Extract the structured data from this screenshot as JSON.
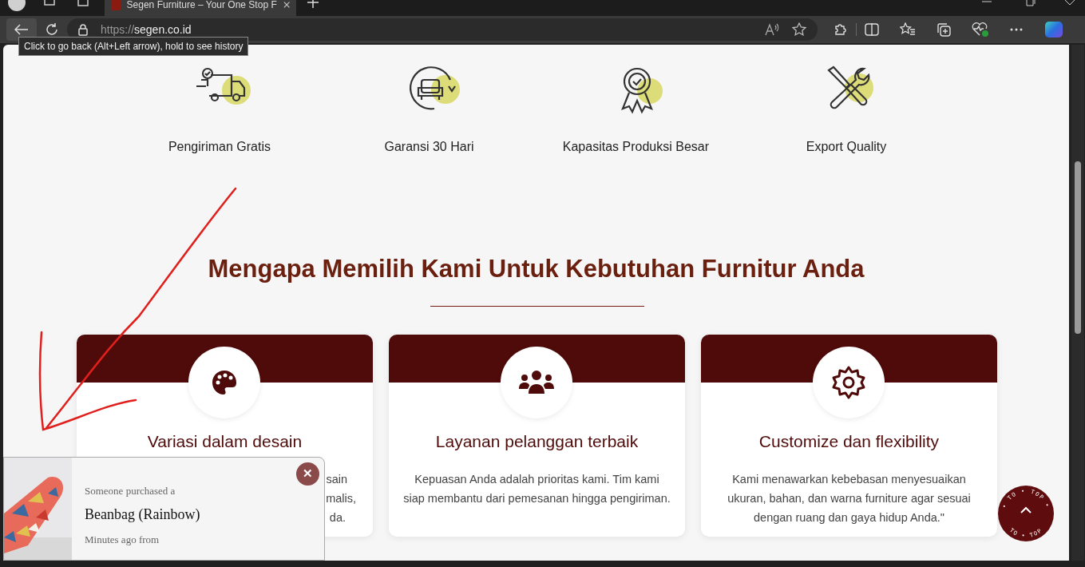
{
  "browser": {
    "tab_title": "Segen Furniture – Your One Stop F",
    "url_scheme": "https://",
    "url_host": "segen.co.id",
    "tooltip": "Click to go back (Alt+Left arrow), hold to see history"
  },
  "features": [
    {
      "kind": "truck",
      "label": "Pengiriman Gratis"
    },
    {
      "kind": "sofa",
      "label": "Garansi 30 Hari"
    },
    {
      "kind": "medal",
      "label": "Kapasitas Produksi Besar"
    },
    {
      "kind": "tools",
      "label": "Export Quality"
    }
  ],
  "section": {
    "heading": "Mengapa Memilih Kami Untuk Kebutuhan Furnitur Anda"
  },
  "cards": [
    {
      "kind": "palette",
      "title": "Variasi dalam desain",
      "description_lines": [
        "sain",
        "malis,",
        "da."
      ]
    },
    {
      "kind": "people",
      "title": "Layanan pelanggan terbaik",
      "description": "Kepuasan Anda adalah prioritas kami. Tim kami siap membantu dari pemesanan hingga pengiriman."
    },
    {
      "kind": "gear",
      "title": "Customize dan flexibility",
      "description": "Kami menawarkan kebebasan menyesuaikan ukuran, bahan, dan warna furniture agar sesuai dengan ruang dan gaya hidup Anda.\""
    }
  ],
  "popup": {
    "line_1": "Someone purchased a",
    "product": "Beanbag (Rainbow)",
    "line_3": "Minutes ago from",
    "close": "✕"
  },
  "to_top": {
    "ring_texts": [
      "• TO • TOP •",
      "TO • TOP"
    ]
  }
}
